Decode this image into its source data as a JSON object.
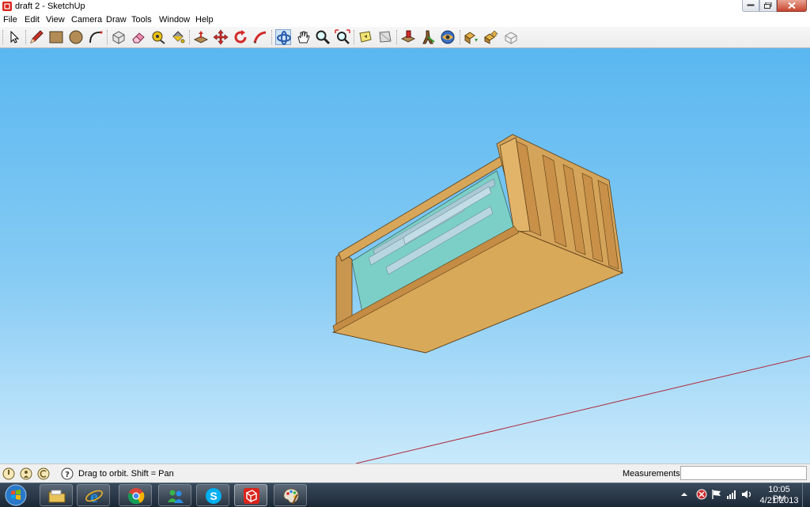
{
  "window": {
    "title": "draft 2 - SketchUp"
  },
  "menu": [
    "File",
    "Edit",
    "View",
    "Camera",
    "Draw",
    "Tools",
    "Window",
    "Help"
  ],
  "toolbar": {
    "tools": [
      {
        "name": "select",
        "icon": "arrow-cursor-icon"
      },
      {
        "name": "pencil",
        "icon": "pencil-icon"
      },
      {
        "name": "rectangle",
        "icon": "rectangle-icon"
      },
      {
        "name": "circle",
        "icon": "circle-icon"
      },
      {
        "name": "arc",
        "icon": "arc-icon"
      },
      {
        "name": "make-component",
        "icon": "component-icon"
      },
      {
        "name": "eraser",
        "icon": "eraser-icon"
      },
      {
        "name": "tape-measure",
        "icon": "tape-measure-icon"
      },
      {
        "name": "paint-bucket",
        "icon": "paint-bucket-icon"
      },
      {
        "name": "push-pull",
        "icon": "push-pull-icon"
      },
      {
        "name": "move",
        "icon": "move-icon"
      },
      {
        "name": "rotate",
        "icon": "rotate-icon"
      },
      {
        "name": "follow-me",
        "icon": "follow-me-icon"
      },
      {
        "name": "orbit",
        "icon": "orbit-icon",
        "active": true
      },
      {
        "name": "pan",
        "icon": "pan-hand-icon"
      },
      {
        "name": "zoom",
        "icon": "zoom-icon"
      },
      {
        "name": "zoom-extents",
        "icon": "zoom-extents-icon"
      },
      {
        "name": "previous-view",
        "icon": "previous-view-icon"
      },
      {
        "name": "next-view",
        "icon": "next-view-icon"
      },
      {
        "name": "position-camera",
        "icon": "position-camera-icon"
      },
      {
        "name": "walk",
        "icon": "walk-icon"
      },
      {
        "name": "look-around",
        "icon": "look-around-icon"
      },
      {
        "name": "get-models",
        "icon": "get-models-icon"
      },
      {
        "name": "share-model",
        "icon": "share-model-icon"
      },
      {
        "name": "share-component",
        "icon": "share-component-icon"
      }
    ]
  },
  "status": {
    "hint": "Drag to orbit.  Shift = Pan",
    "measurements_label": "Measurements",
    "measurements_value": ""
  },
  "taskbar": {
    "apps": [
      {
        "name": "explorer",
        "icon": "folder-icon"
      },
      {
        "name": "internet-explorer",
        "icon": "ie-icon"
      },
      {
        "name": "chrome",
        "icon": "chrome-icon"
      },
      {
        "name": "messenger",
        "icon": "messenger-icon"
      },
      {
        "name": "skype",
        "icon": "skype-icon"
      },
      {
        "name": "sketchup",
        "icon": "sketchup-icon",
        "current": true
      },
      {
        "name": "paint",
        "icon": "paint-palette-icon"
      }
    ],
    "time": "10:05 PM",
    "date": "4/21/2013"
  },
  "colors": {
    "sky_top": "#5ab7f0",
    "sky_bottom": "#c9e9fb",
    "wood": "#d9a95a",
    "glass": "#78c8c4",
    "axis_red": "#b0263a"
  }
}
